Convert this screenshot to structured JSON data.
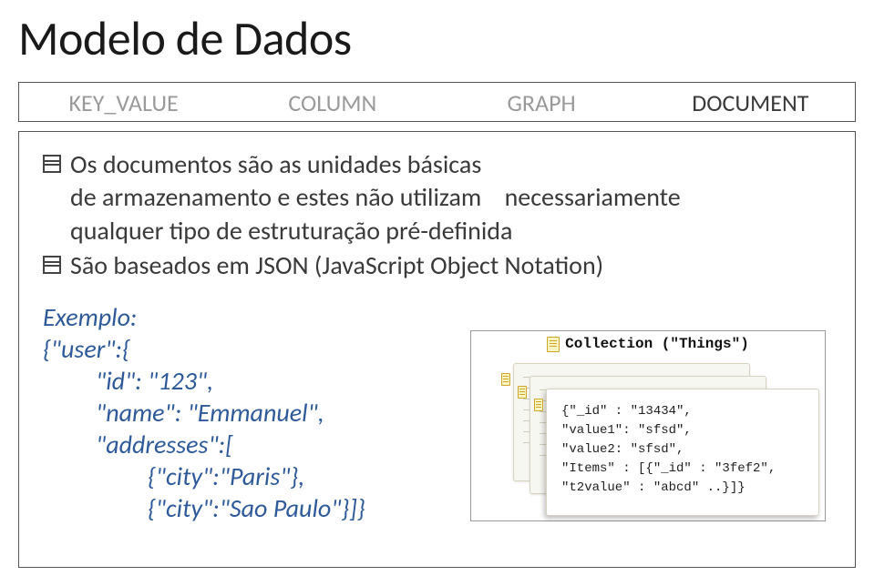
{
  "title": "Modelo de Dados",
  "tabs": {
    "items": [
      "KEY_VALUE",
      "COLUMN",
      "GRAPH",
      "DOCUMENT"
    ]
  },
  "bullets": {
    "b1_line1": "Os documentos são as unidades básicas",
    "b1_line2_left": "de armazenamento e estes não utilizam",
    "b1_line2_gap": "    ",
    "b1_line2_right": "necessariamente",
    "b1_line3": "qualquer tipo de estruturação pré-definida",
    "b2": "São baseados em JSON (JavaScript Object Notation)"
  },
  "example": {
    "label": "Exemplo:",
    "l1": "{\"user\":{",
    "l2": "\"id\": \"123\",",
    "l3": "\"name\": \"Emmanuel\",",
    "l4": "\"addresses\":[",
    "l5": "{\"city\":\"Paris\"},",
    "l6": "{\"city\":\"Sao Paulo\"}]}"
  },
  "collection": {
    "title": "Collection (\"Things\")",
    "doc_lines": [
      "{\"_id\" : \"13434\",",
      " \"value1\": \"sfsd\",",
      " \"value2: \"sfsd\",",
      " \"Items\" : [{\"_id\" : \"3fef2\",",
      "  \"t2value\" : \"abcd\" ..}]}"
    ]
  }
}
